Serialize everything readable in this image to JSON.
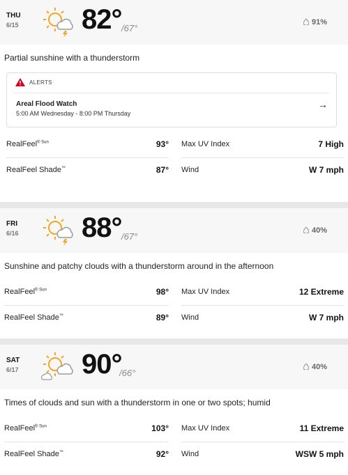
{
  "days": [
    {
      "dow": "THU",
      "date": "6/15",
      "high": "82°",
      "low": "/67°",
      "precip": "91%",
      "phrase": "Partial sunshine with a thunderstorm",
      "alert": {
        "header": "ALERTS",
        "title": "Areal Flood Watch",
        "time": "5:00 AM Wednesday - 8:00 PM Thursday",
        "arrow": "→"
      },
      "realfeel_sun_label": "RealFeel",
      "realfeel_sun_suffix": "® Sun",
      "realfeel_sun": "93°",
      "uv_label": "Max UV Index",
      "uv": "7 High",
      "realfeel_shade_label": "RealFeel Shade",
      "realfeel_shade_suffix": "™",
      "realfeel_shade": "87°",
      "wind_label": "Wind",
      "wind": "W 7 mph"
    },
    {
      "dow": "FRI",
      "date": "6/16",
      "high": "88°",
      "low": "/67°",
      "precip": "40%",
      "phrase": "Sunshine and patchy clouds with a thunderstorm around in the afternoon",
      "realfeel_sun_label": "RealFeel",
      "realfeel_sun_suffix": "® Sun",
      "realfeel_sun": "98°",
      "uv_label": "Max UV Index",
      "uv": "12 Extreme",
      "realfeel_shade_label": "RealFeel Shade",
      "realfeel_shade_suffix": "™",
      "realfeel_shade": "89°",
      "wind_label": "Wind",
      "wind": "W 7 mph"
    },
    {
      "dow": "SAT",
      "date": "6/17",
      "high": "90°",
      "low": "/66°",
      "precip": "40%",
      "phrase": "Times of clouds and sun with a thunderstorm in one or two spots; humid",
      "realfeel_sun_label": "RealFeel",
      "realfeel_sun_suffix": "® Sun",
      "realfeel_sun": "103°",
      "uv_label": "Max UV Index",
      "uv": "11 Extreme",
      "realfeel_shade_label": "RealFeel Shade",
      "realfeel_shade_suffix": "™",
      "realfeel_shade": "92°",
      "wind_label": "Wind",
      "wind": "WSW 5 mph"
    }
  ],
  "colors": {
    "sun": "#f5a623",
    "cloud": "#9b9b9b",
    "bolt": "#f5a623",
    "alert_red": "#d0021b"
  }
}
